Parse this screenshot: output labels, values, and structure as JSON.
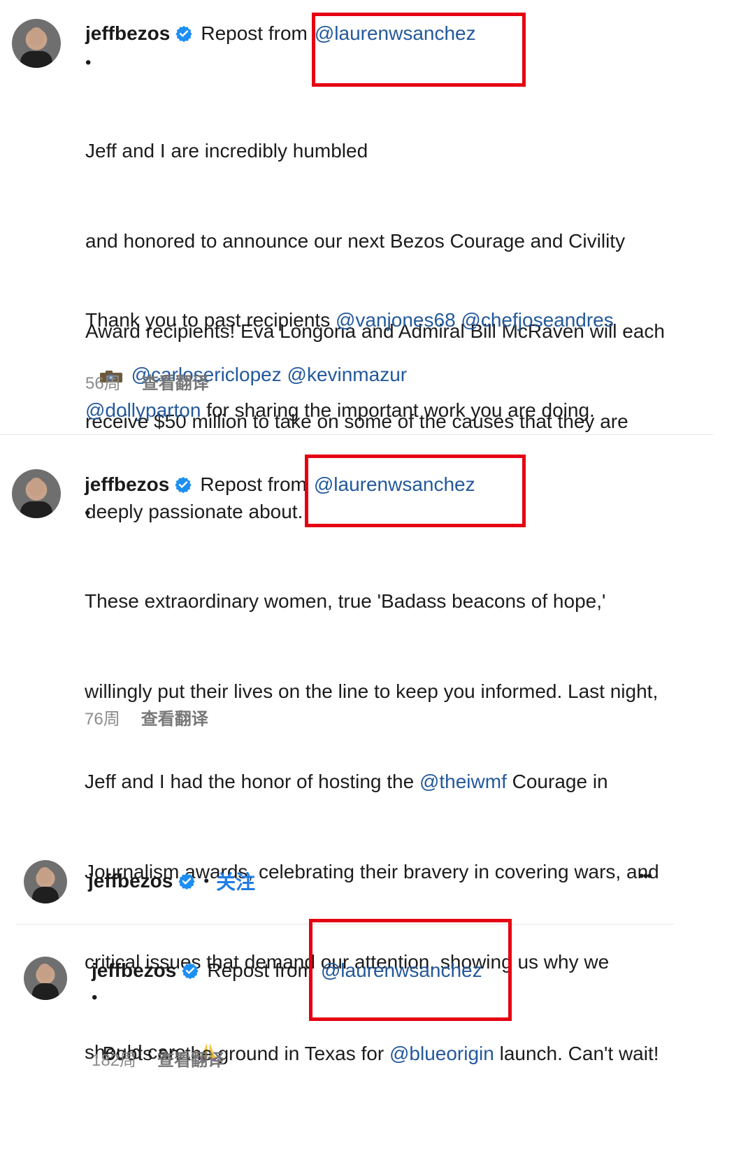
{
  "post1": {
    "username": "jeffbezos",
    "repost_label": "Repost from",
    "repost_handle": "@laurenwsanchez",
    "bullet": "•",
    "lines": [
      "Jeff and I are incredibly humbled",
      "and honored to announce our next Bezos Courage and Civility",
      "Award recipients! Eva Longoria and Admiral Bill McRaven will each",
      "receive $50 million to take on some of the causes that they are",
      "deeply passionate about."
    ],
    "thanks_prefix": "Thank you to past recipients ",
    "thanks_mention1": "@vanjones68",
    "thanks_mention2": "@chefjoseandres",
    "thanks_mention3": "@dollyparton",
    "thanks_suffix": " for sharing the important work you are doing.",
    "credit_mention1": "@carlosericlopez",
    "credit_mention2": "@kevinmazur",
    "age": "56周",
    "translate": "查看翻译"
  },
  "post2": {
    "username": "jeffbezos",
    "repost_label": "Repost from",
    "repost_handle": "@laurenwsanchez",
    "bullet": "•",
    "line1": "These extraordinary women, true 'Badass beacons of hope,'",
    "line2": "willingly put their lives on the line to keep you informed. Last night,",
    "line3_prefix": "Jeff and I had the honor of hosting the ",
    "line3_mention": "@theiwmf",
    "line3_suffix": " Courage in",
    "line4": "Journalism awards, celebrating their bravery in covering wars, and",
    "line5": "critical issues that demand our attention, showing us why we",
    "line6": "should care. ",
    "age": "76周",
    "translate": "查看翻译"
  },
  "post3_header": {
    "username": "jeffbezos",
    "separator": "•",
    "follow": "关注",
    "more": "•••"
  },
  "post3": {
    "username": "jeffbezos",
    "repost_label": "Repost from",
    "repost_handle": "@laurenwsanchez",
    "bullet": "•",
    "text_prefix": "Boots on the ground in Texas for ",
    "text_mention": "@blueorigin",
    "text_suffix": " launch. Can't wait!",
    "age": "182周",
    "translate": "查看翻译"
  },
  "colors": {
    "mention": "#24599b",
    "follow": "#1f7ce6",
    "highlight_box": "#e50012",
    "meta": "#8c8c8c"
  },
  "icons": {
    "verified": "verified-badge-icon",
    "camera": "camera-icon",
    "pray": "folded-hands-emoji",
    "more": "more-options-icon"
  }
}
